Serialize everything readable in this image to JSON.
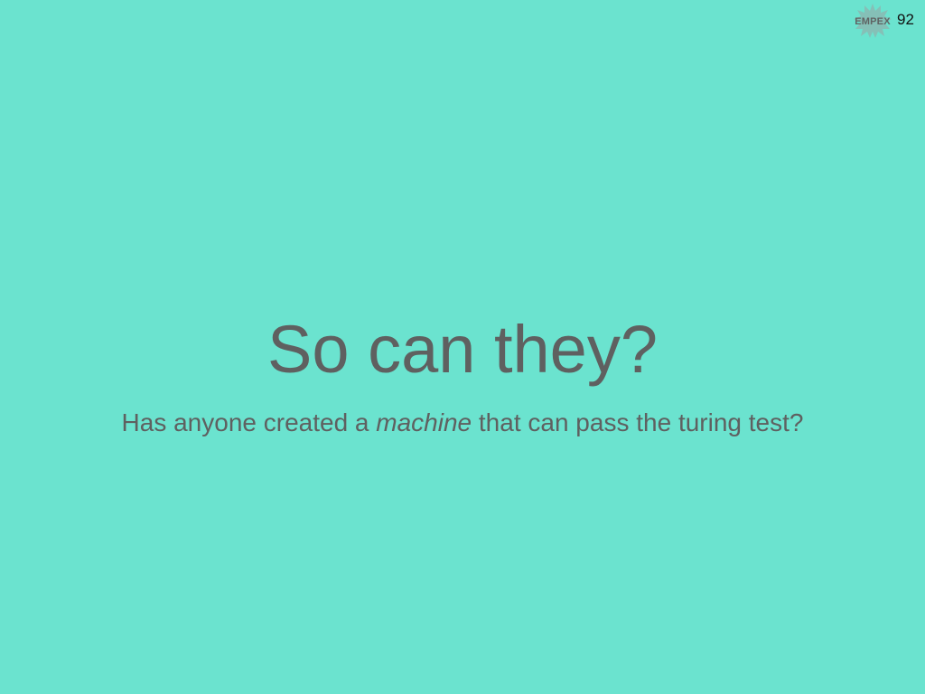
{
  "slide": {
    "logo_text": "EMPEX",
    "slide_number": "92",
    "title": "So can they?",
    "subtitle_before": "Has anyone created a ",
    "subtitle_emphasis": "machine",
    "subtitle_after": " that can pass the turing test?"
  },
  "colors": {
    "background": "#6be3cf",
    "text": "#5f6060",
    "logo": "#5f6363",
    "number": "#111111"
  }
}
